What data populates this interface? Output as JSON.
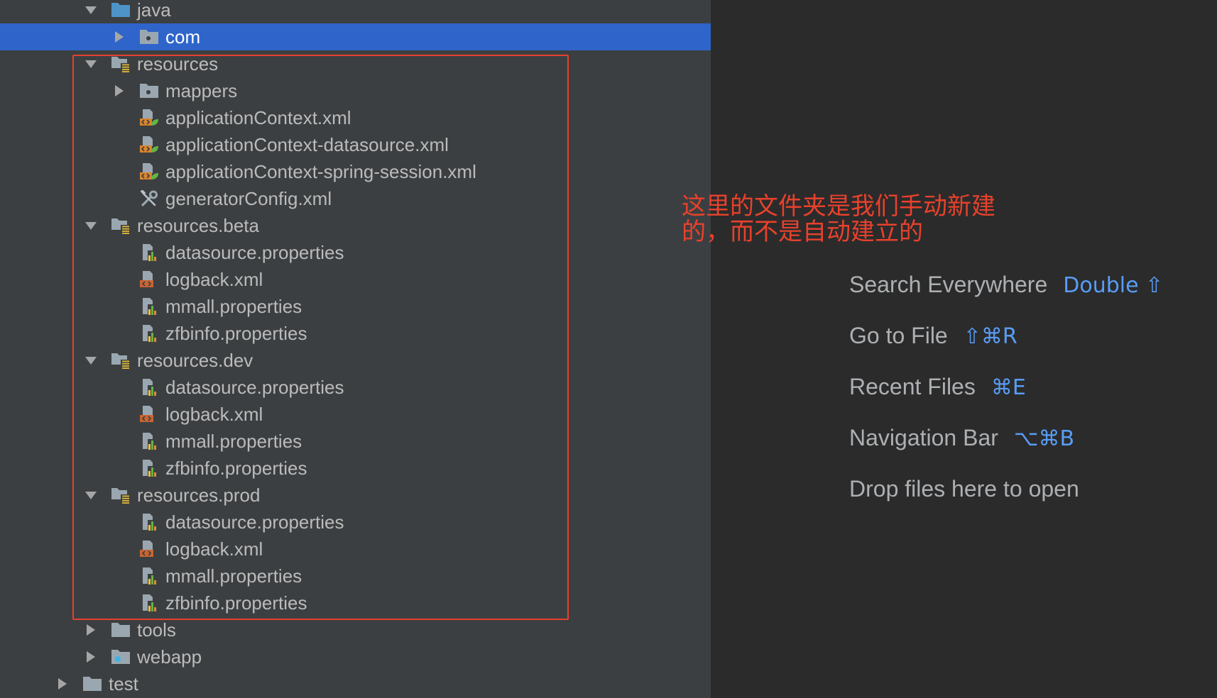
{
  "tree": [
    {
      "label": "java",
      "level": 1,
      "arrow": "expanded",
      "icon": "source-folder-icon"
    },
    {
      "label": "com",
      "level": 2,
      "arrow": "collapsed",
      "icon": "package-folder-icon",
      "selected": true
    },
    {
      "label": "resources",
      "level": 1,
      "arrow": "expanded",
      "icon": "resource-folder-icon"
    },
    {
      "label": "mappers",
      "level": 2,
      "arrow": "collapsed",
      "icon": "package-folder-icon"
    },
    {
      "label": "applicationContext.xml",
      "level": 2,
      "arrow": "none",
      "icon": "spring-xml-icon"
    },
    {
      "label": "applicationContext-datasource.xml",
      "level": 2,
      "arrow": "none",
      "icon": "spring-xml-icon"
    },
    {
      "label": "applicationContext-spring-session.xml",
      "level": 2,
      "arrow": "none",
      "icon": "spring-xml-icon"
    },
    {
      "label": "generatorConfig.xml",
      "level": 2,
      "arrow": "none",
      "icon": "tools-icon"
    },
    {
      "label": "resources.beta",
      "level": 1,
      "arrow": "expanded",
      "icon": "resource-folder-icon"
    },
    {
      "label": "datasource.properties",
      "level": 2,
      "arrow": "none",
      "icon": "properties-icon"
    },
    {
      "label": "logback.xml",
      "level": 2,
      "arrow": "none",
      "icon": "xml-icon"
    },
    {
      "label": "mmall.properties",
      "level": 2,
      "arrow": "none",
      "icon": "properties-icon"
    },
    {
      "label": "zfbinfo.properties",
      "level": 2,
      "arrow": "none",
      "icon": "properties-icon"
    },
    {
      "label": "resources.dev",
      "level": 1,
      "arrow": "expanded",
      "icon": "resource-folder-icon"
    },
    {
      "label": "datasource.properties",
      "level": 2,
      "arrow": "none",
      "icon": "properties-icon"
    },
    {
      "label": "logback.xml",
      "level": 2,
      "arrow": "none",
      "icon": "xml-icon"
    },
    {
      "label": "mmall.properties",
      "level": 2,
      "arrow": "none",
      "icon": "properties-icon"
    },
    {
      "label": "zfbinfo.properties",
      "level": 2,
      "arrow": "none",
      "icon": "properties-icon"
    },
    {
      "label": "resources.prod",
      "level": 1,
      "arrow": "expanded",
      "icon": "resource-folder-icon"
    },
    {
      "label": "datasource.properties",
      "level": 2,
      "arrow": "none",
      "icon": "properties-icon"
    },
    {
      "label": "logback.xml",
      "level": 2,
      "arrow": "none",
      "icon": "xml-icon"
    },
    {
      "label": "mmall.properties",
      "level": 2,
      "arrow": "none",
      "icon": "properties-icon"
    },
    {
      "label": "zfbinfo.properties",
      "level": 2,
      "arrow": "none",
      "icon": "properties-icon"
    },
    {
      "label": "tools",
      "level": 1,
      "arrow": "collapsed",
      "icon": "folder-icon"
    },
    {
      "label": "webapp",
      "level": 1,
      "arrow": "collapsed",
      "icon": "web-folder-icon"
    },
    {
      "label": "test",
      "level": 0,
      "arrow": "collapsed",
      "icon": "folder-icon"
    }
  ],
  "annotation": {
    "line1": "这里的文件夹是我们手动新建",
    "line2": "的，而不是自动建立的"
  },
  "hints": [
    {
      "label": "Search Everywhere",
      "shortcut": "Double ⇧"
    },
    {
      "label": "Go to File",
      "shortcut": "⇧⌘R"
    },
    {
      "label": "Recent Files",
      "shortcut": "⌘E"
    },
    {
      "label": "Navigation Bar",
      "shortcut": "⌥⌘B"
    },
    {
      "label": "Drop files here to open"
    }
  ],
  "colors": {
    "sidebar_background": "#3c3f41",
    "editor_background": "#2b2b2b",
    "selection": "#2f65ca",
    "annotation_red": "#e8412c",
    "shortcut_blue": "#589df6"
  }
}
